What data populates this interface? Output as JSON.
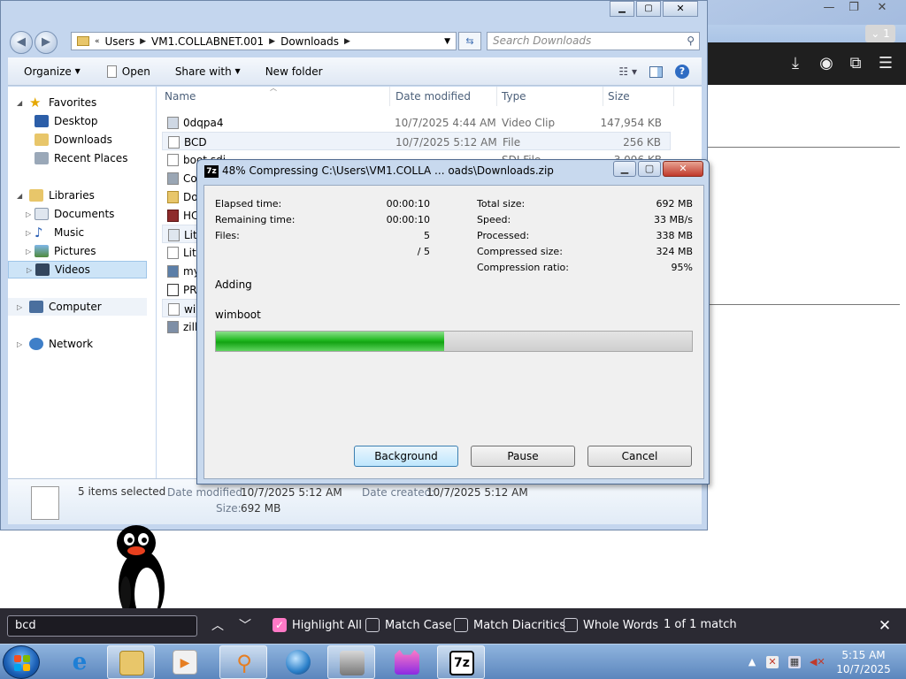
{
  "browser": {
    "tab_count": "1",
    "controls": {
      "minimize": "—",
      "maximize": "❐",
      "close": "✕"
    }
  },
  "explorer": {
    "breadcrumb": [
      "Users",
      "VM1.COLLABNET.001",
      "Downloads"
    ],
    "search_placeholder": "Search Downloads",
    "commands": {
      "organize": "Organize",
      "open": "Open",
      "share_with": "Share with",
      "new_folder": "New folder"
    },
    "nav": {
      "favorites": "Favorites",
      "favorites_items": [
        "Desktop",
        "Downloads",
        "Recent Places"
      ],
      "libraries": "Libraries",
      "libraries_items": [
        "Documents",
        "Music",
        "Pictures",
        "Videos"
      ],
      "computer": "Computer",
      "network": "Network"
    },
    "columns": {
      "name": "Name",
      "date": "Date modified",
      "type": "Type",
      "size": "Size"
    },
    "files": [
      {
        "name": "0dqpa4",
        "date": "10/7/2025 4:44 AM",
        "type": "Video Clip",
        "size": "147,954 KB"
      },
      {
        "name": "BCD",
        "date": "10/7/2025 5:12 AM",
        "type": "File",
        "size": "256 KB"
      },
      {
        "name": "boot.sdi",
        "date": "",
        "type": "SDI File",
        "size": "3,096 KB"
      },
      {
        "name": "Co",
        "date": "",
        "type": "",
        "size": ""
      },
      {
        "name": "Do",
        "date": "",
        "type": "",
        "size": ""
      },
      {
        "name": "HC",
        "date": "",
        "type": "",
        "size": ""
      },
      {
        "name": "Lite",
        "date": "",
        "type": "",
        "size": ""
      },
      {
        "name": "Lite",
        "date": "",
        "type": "",
        "size": ""
      },
      {
        "name": "my",
        "date": "",
        "type": "",
        "size": ""
      },
      {
        "name": "PR",
        "date": "",
        "type": "",
        "size": ""
      },
      {
        "name": "wir",
        "date": "",
        "type": "",
        "size": ""
      },
      {
        "name": "zille",
        "date": "",
        "type": "",
        "size": ""
      }
    ],
    "details": {
      "selected": "5 items selected",
      "date_modified_label": "Date modified:",
      "date_modified": "10/7/2025 5:12 AM",
      "date_created_label": "Date created:",
      "date_created": "10/7/2025 5:12 AM",
      "size_label": "Size:",
      "size": "692 MB"
    }
  },
  "zip_dialog": {
    "icon_text": "7z",
    "title": "48% Compressing C:\\Users\\VM1.COLLA ... oads\\Downloads.zip",
    "progress_fraction": 0.48,
    "left": {
      "elapsed_label": "Elapsed time:",
      "elapsed": "00:00:10",
      "remaining_label": "Remaining time:",
      "remaining": "00:00:10",
      "files_label": "Files:",
      "files": "5",
      "files_total": "/ 5"
    },
    "right": {
      "total_size_label": "Total size:",
      "total_size": "692 MB",
      "speed_label": "Speed:",
      "speed": "33 MB/s",
      "processed_label": "Processed:",
      "processed": "338 MB",
      "compressed_label": "Compressed size:",
      "compressed": "324 MB",
      "ratio_label": "Compression ratio:",
      "ratio": "95%"
    },
    "action": "Adding",
    "current_file": "wimboot",
    "buttons": {
      "background": "Background",
      "pause": "Pause",
      "cancel": "Cancel"
    }
  },
  "findbar": {
    "query": "bcd",
    "highlight_all": "Highlight All",
    "match_case": "Match Case",
    "match_diacritics": "Match Diacritics",
    "whole_words": "Whole Words",
    "result": "1 of 1 match",
    "highlight_all_checked": true
  },
  "taskbar": {
    "time": "5:15 AM",
    "date": "10/7/2025"
  },
  "colors": {
    "progress_green": "#13a313",
    "findbar_bg": "#2b2a33",
    "checkbox_accent": "#ff79c6"
  }
}
